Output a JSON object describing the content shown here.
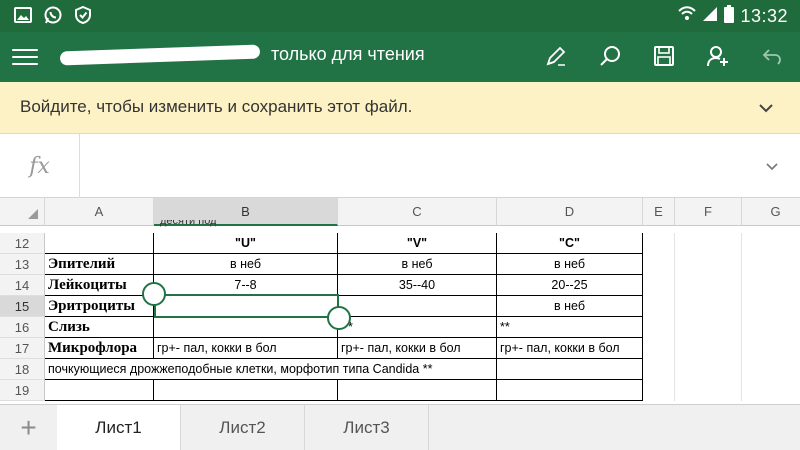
{
  "status_bar": {
    "time": "13:32",
    "left_icons": [
      "gallery-icon",
      "whatsapp-icon",
      "shield-icon"
    ],
    "right_icons": [
      "wifi-icon",
      "signal-icon",
      "battery-icon"
    ]
  },
  "app_bar": {
    "title": "только для чтения",
    "actions": [
      "pen-icon",
      "search-icon",
      "save-icon",
      "share-person-icon",
      "undo-icon"
    ],
    "color": "#217346"
  },
  "message_bar": {
    "text": "Войдите, чтобы изменить и сохранить этот файл.",
    "background": "#fdf2c5"
  },
  "formula_bar": {
    "fx_label": "fx",
    "value": ""
  },
  "grid": {
    "columns": [
      "A",
      "B",
      "C",
      "D",
      "E",
      "F",
      "G"
    ],
    "selected_column": "B",
    "rows": [
      "12",
      "13",
      "14",
      "15",
      "16",
      "17",
      "18",
      "19"
    ],
    "selected_row": "15",
    "partial_top_text": "десяти под",
    "cells": {
      "r12": {
        "A": "",
        "B": "\"U\"",
        "C": "\"V\"",
        "D": "\"C\""
      },
      "r13": {
        "A": "Эпителий",
        "B": "в неб",
        "C": "в неб",
        "D": "в неб"
      },
      "r14": {
        "A": "Лейкоциты",
        "B": "7--8",
        "C": "35--40",
        "D": "20--25"
      },
      "r15": {
        "A": "Эритроциты",
        "B": "",
        "C": "",
        "D": "в неб"
      },
      "r16": {
        "A": "Слизь",
        "B": "",
        "C": "*",
        "D": "**"
      },
      "r17": {
        "A": "Микрофлора",
        "B": "гр+- пал, кокки в бол",
        "C": "гр+- пал, кокки в бол",
        "D": "гр+- пал, кокки в бол"
      },
      "r18": {
        "A": "почкующиеся  дрожжеподобные клетки, морфотип типа Candida **",
        "D": ""
      },
      "r19": {
        "A": "",
        "B": "",
        "C": "",
        "D": ""
      }
    }
  },
  "sheets": {
    "add_label": "+",
    "tabs": [
      "Лист1",
      "Лист2",
      "Лист3"
    ],
    "active": "Лист1"
  }
}
